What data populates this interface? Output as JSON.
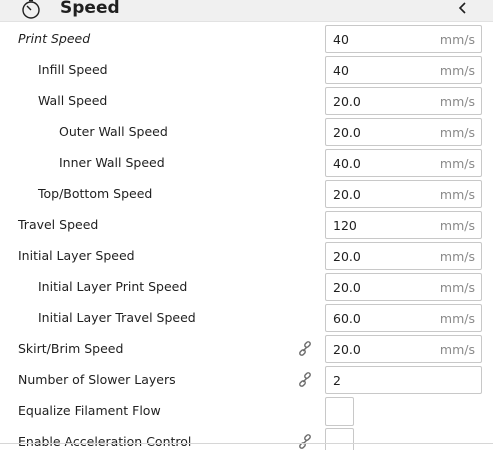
{
  "header": {
    "title": "Speed",
    "icon": "speedometer-icon",
    "collapse_icon": "chevron-left-icon"
  },
  "settings": [
    {
      "label": "Print Speed",
      "value": "40",
      "unit": "mm/s",
      "level": 0,
      "italic": true,
      "linked": false,
      "kind": "number"
    },
    {
      "label": "Infill Speed",
      "value": "40",
      "unit": "mm/s",
      "level": 1,
      "italic": false,
      "linked": false,
      "kind": "number"
    },
    {
      "label": "Wall Speed",
      "value": "20.0",
      "unit": "mm/s",
      "level": 1,
      "italic": false,
      "linked": false,
      "kind": "number"
    },
    {
      "label": "Outer Wall Speed",
      "value": "20.0",
      "unit": "mm/s",
      "level": 2,
      "italic": false,
      "linked": false,
      "kind": "number"
    },
    {
      "label": "Inner Wall Speed",
      "value": "40.0",
      "unit": "mm/s",
      "level": 2,
      "italic": false,
      "linked": false,
      "kind": "number"
    },
    {
      "label": "Top/Bottom Speed",
      "value": "20.0",
      "unit": "mm/s",
      "level": 1,
      "italic": false,
      "linked": false,
      "kind": "number"
    },
    {
      "label": "Travel Speed",
      "value": "120",
      "unit": "mm/s",
      "level": 0,
      "italic": false,
      "linked": false,
      "kind": "number"
    },
    {
      "label": "Initial Layer Speed",
      "value": "20.0",
      "unit": "mm/s",
      "level": 0,
      "italic": false,
      "linked": false,
      "kind": "number"
    },
    {
      "label": "Initial Layer Print Speed",
      "value": "20.0",
      "unit": "mm/s",
      "level": 1,
      "italic": false,
      "linked": false,
      "kind": "number"
    },
    {
      "label": "Initial Layer Travel Speed",
      "value": "60.0",
      "unit": "mm/s",
      "level": 1,
      "italic": false,
      "linked": false,
      "kind": "number"
    },
    {
      "label": "Skirt/Brim Speed",
      "value": "20.0",
      "unit": "mm/s",
      "level": 0,
      "italic": false,
      "linked": true,
      "kind": "number"
    },
    {
      "label": "Number of Slower Layers",
      "value": "2",
      "unit": "",
      "level": 0,
      "italic": false,
      "linked": true,
      "kind": "number"
    },
    {
      "label": "Equalize Filament Flow",
      "value": "",
      "unit": "",
      "level": 0,
      "italic": false,
      "linked": false,
      "kind": "checkbox",
      "checked": false
    },
    {
      "label": "Enable Acceleration Control",
      "value": "",
      "unit": "",
      "level": 0,
      "italic": false,
      "linked": true,
      "kind": "checkbox",
      "checked": false
    }
  ],
  "colors": {
    "header_bg": "#f0f0f0",
    "field_border": "#c8c8c8",
    "unit_text": "#8a8a8a"
  }
}
